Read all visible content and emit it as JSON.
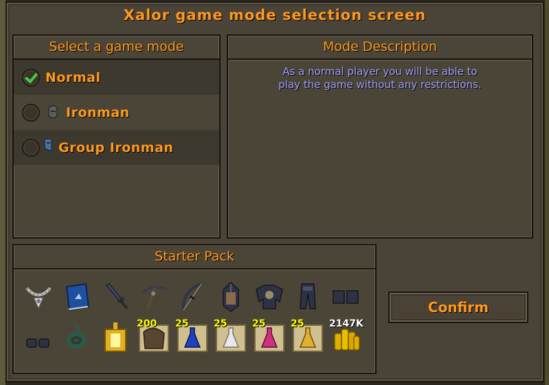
{
  "window": {
    "title": "Xalor game mode selection screen"
  },
  "modes_panel": {
    "header": "Select a game mode",
    "items": [
      {
        "label": "Normal",
        "selected": true,
        "icon": "none"
      },
      {
        "label": "Ironman",
        "selected": false,
        "icon": "ironman-helm-icon"
      },
      {
        "label": "Group Ironman",
        "selected": false,
        "icon": "group-ironman-helm-icon"
      }
    ]
  },
  "description_panel": {
    "header": "Mode Description",
    "line1": "As a normal player you will be able to",
    "line2": "play the game without any restrictions."
  },
  "starter_pack": {
    "header": "Starter Pack",
    "items": [
      {
        "icon": "amulet-icon"
      },
      {
        "icon": "spellbook-icon"
      },
      {
        "icon": "dagger-icon"
      },
      {
        "icon": "crossbow-icon"
      },
      {
        "icon": "bow-icon"
      },
      {
        "icon": "helmet-icon"
      },
      {
        "icon": "platebody-icon"
      },
      {
        "icon": "platelegs-icon"
      },
      {
        "icon": "boots-icon"
      },
      {
        "icon": "gloves-icon"
      },
      {
        "icon": "rope-icon"
      },
      {
        "icon": "lantern-icon"
      },
      {
        "icon": "sack-icon",
        "quantity": "200"
      },
      {
        "icon": "blue-potion-icon",
        "quantity": "25"
      },
      {
        "icon": "white-potion-icon",
        "quantity": "25"
      },
      {
        "icon": "pink-potion-icon",
        "quantity": "25"
      },
      {
        "icon": "yellow-potion-icon",
        "quantity": "25"
      },
      {
        "icon": "coins-icon",
        "quantity": "2147K"
      }
    ]
  },
  "confirm_button": {
    "label": "Confirm"
  },
  "colors": {
    "title_orange": "#ff981f",
    "description_blue": "#9f9fff",
    "check_green": "#47c94a"
  }
}
